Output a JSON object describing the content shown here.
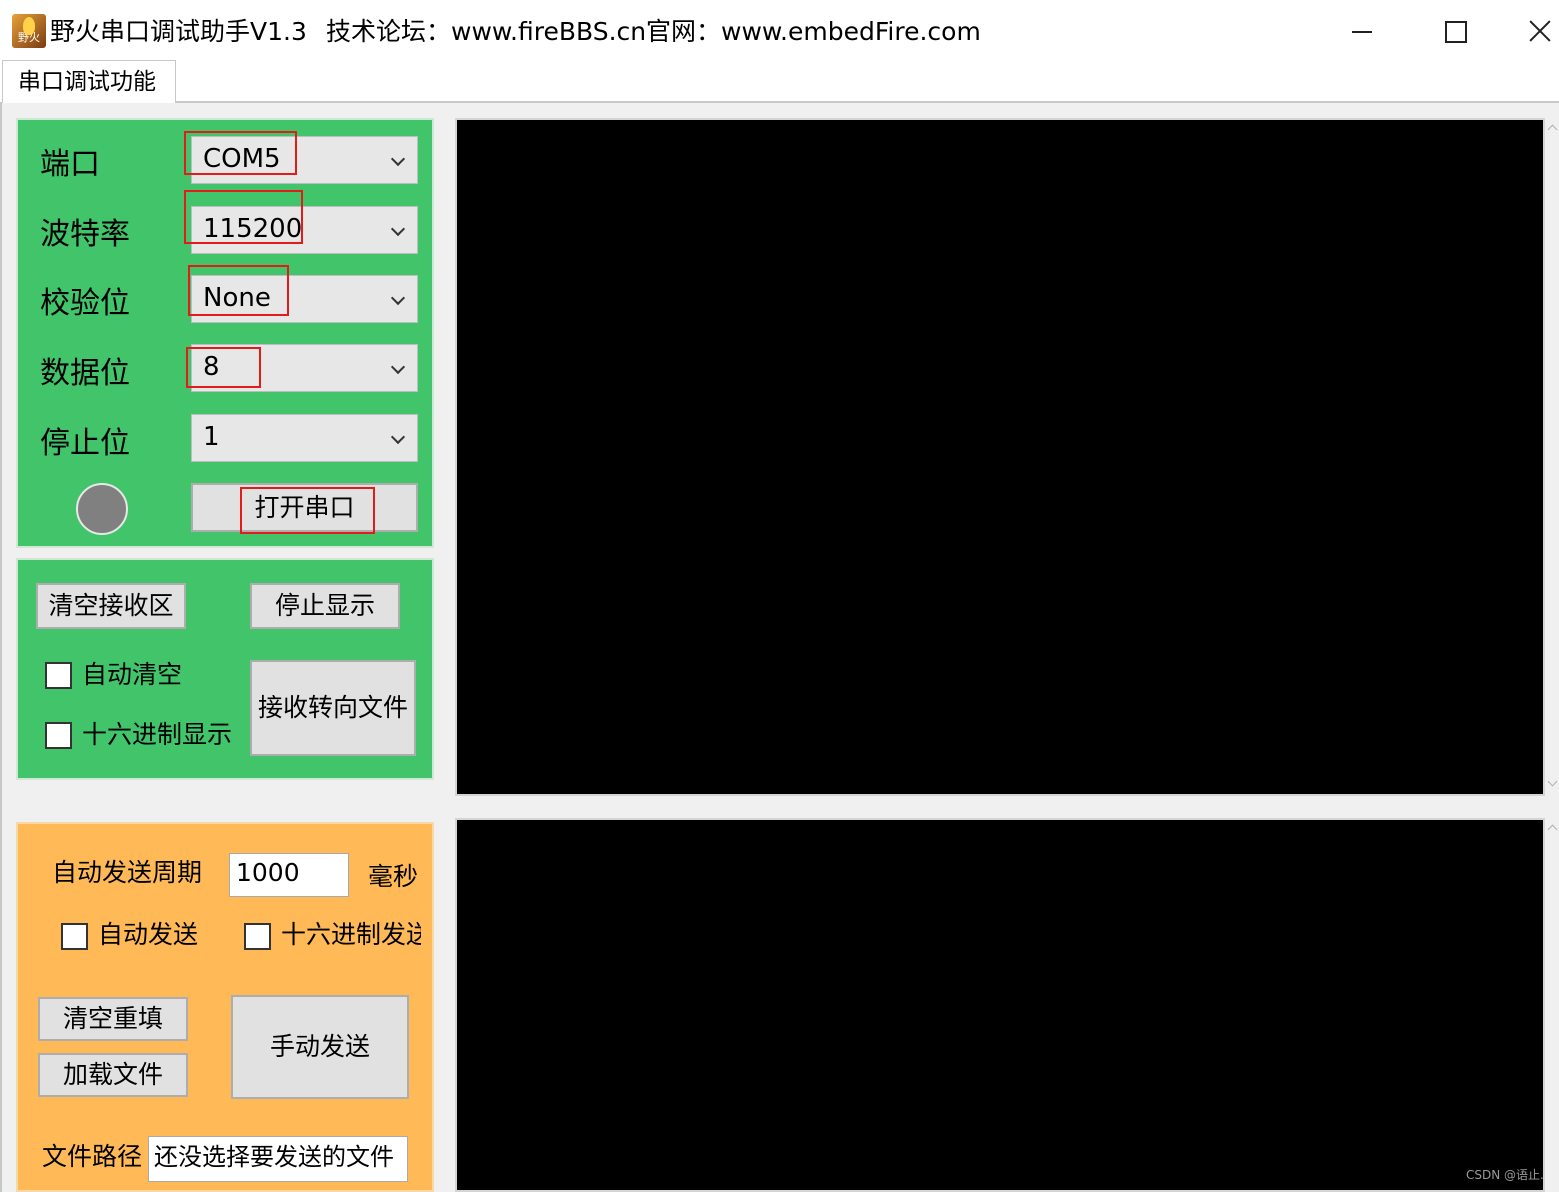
{
  "window": {
    "title": "野火串口调试助手V1.3",
    "forum": "技术论坛：www.fireBBS.cn",
    "site": "官网：www.embedFire.com",
    "icon": "flame-app-icon",
    "icon_text": "野火"
  },
  "tabs": [
    {
      "label": "串口调试功能",
      "selected": true
    }
  ],
  "serial_settings": {
    "port": {
      "label": "端口",
      "value": "COM5"
    },
    "baud": {
      "label": "波特率",
      "value": "115200"
    },
    "parity": {
      "label": "校验位",
      "value": "None"
    },
    "databits": {
      "label": "数据位",
      "value": "8"
    },
    "stopbits": {
      "label": "停止位",
      "value": "1"
    },
    "status_led_color": "#808080",
    "open_button": "打开串口"
  },
  "receive_panel": {
    "clear_button": "清空接收区",
    "stop_button": "停止显示",
    "auto_clear": {
      "label": "自动清空",
      "checked": false
    },
    "hex_display": {
      "label": "十六进制显示",
      "checked": false
    },
    "redirect_button": "接收转向文件"
  },
  "send_panel": {
    "period_label": "自动发送周期",
    "period_value": "1000",
    "period_unit": "毫秒",
    "auto_send": {
      "label": "自动发送",
      "checked": false
    },
    "hex_send": {
      "label": "十六进制发送",
      "checked": false
    },
    "clear_refill_button": "清空重填",
    "load_file_button": "加载文件",
    "manual_send_button": "手动发送",
    "file_path_label": "文件路径",
    "file_path_value": "还没选择要发送的文件"
  },
  "colors": {
    "serial_panel": "#41c46a",
    "send_panel": "#ffb957",
    "terminal": "#000000",
    "highlight": "#e21b1b"
  },
  "watermark": "CSDN @语止."
}
